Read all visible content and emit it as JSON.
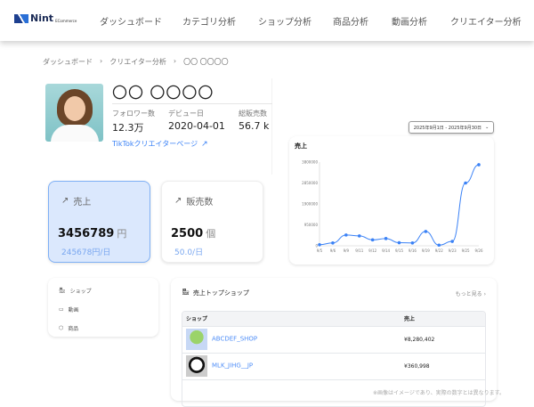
{
  "header": {
    "logo": "Nint ECommerce",
    "nav": [
      "ダッシュボード",
      "カテゴリ分析",
      "ショップ分析",
      "商品分析",
      "動画分析",
      "クリエイター分析"
    ]
  },
  "breadcrumb": [
    "ダッシュボード",
    "クリエイター分析",
    "〇〇 〇〇〇〇"
  ],
  "profile": {
    "name": "〇〇 〇〇〇〇",
    "followers_label": "フォロワー数",
    "followers": "12.3万",
    "debut_label": "デビュー日",
    "debut": "2020-04-01",
    "sales_label": "総販売数",
    "sales": "56.7 k",
    "link": "TikTokクリエイターページ"
  },
  "kpis": [
    {
      "title": "売上",
      "value": "3456789",
      "unit": "円",
      "sub": "245678円/日",
      "selected": true
    },
    {
      "title": "販売数",
      "value": "2500",
      "unit": "個",
      "sub": "50.0/日",
      "selected": false
    }
  ],
  "date_range": "2025年9月1日 - 2025年9月30日",
  "chart_data": {
    "type": "line",
    "title": "売上",
    "categories": [
      "9/5",
      "9/6",
      "9/9",
      "9/11",
      "9/12",
      "9/14",
      "9/15",
      "9/16",
      "9/19",
      "9/22",
      "9/23",
      "9/25",
      "9/26"
    ],
    "values": [
      50000,
      130000,
      490000,
      450000,
      270000,
      330000,
      140000,
      130000,
      650000,
      30000,
      200000,
      2850000,
      3680000
    ],
    "yticks": [
      0,
      950000,
      1900000,
      2850000,
      3800000
    ],
    "ylim": [
      0,
      3800000
    ],
    "color": "#3b82f6",
    "grid": false
  },
  "side_menu": [
    "ショップ",
    "動画",
    "商品"
  ],
  "top_shops": {
    "title": "売上トップショップ",
    "more": "もっと見る",
    "columns": [
      "ショップ",
      "売上"
    ],
    "rows": [
      {
        "name": "ABCDEF_SHOP",
        "sales": "¥8,280,402"
      },
      {
        "name": "MLK_JIHG__JP",
        "sales": "¥360,998"
      }
    ]
  },
  "note": "※画像はイメージであり、実際の数字とは異なります。"
}
